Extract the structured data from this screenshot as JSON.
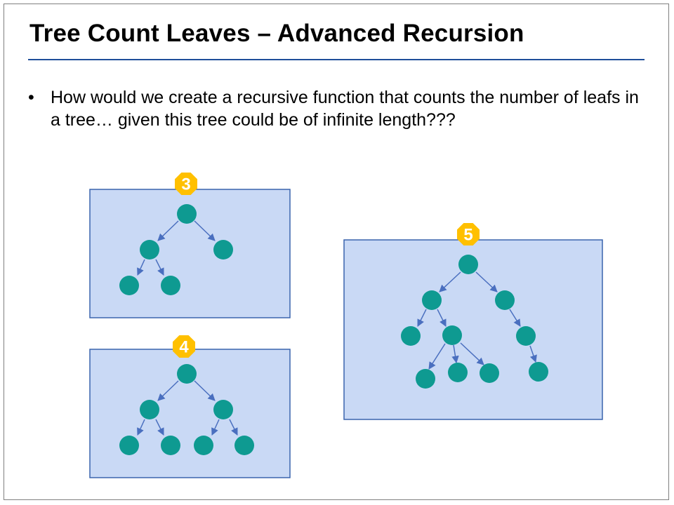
{
  "slide": {
    "title": "Tree Count Leaves – Advanced Recursion",
    "bullet_marker": "•",
    "bullets": [
      "How would we create a recursive function that counts the number of leafs in a tree… given this tree could be of infinite length???"
    ]
  },
  "trees": [
    {
      "leaf_count": "3"
    },
    {
      "leaf_count": "4"
    },
    {
      "leaf_count": "5"
    }
  ],
  "colors": {
    "box_fill": "#c9d9f5",
    "box_stroke": "#3a64ad",
    "node": "#0e9a91",
    "edge": "#4a6fbf",
    "badge": "#ffc000",
    "title_rule": "#1f4e9a"
  }
}
